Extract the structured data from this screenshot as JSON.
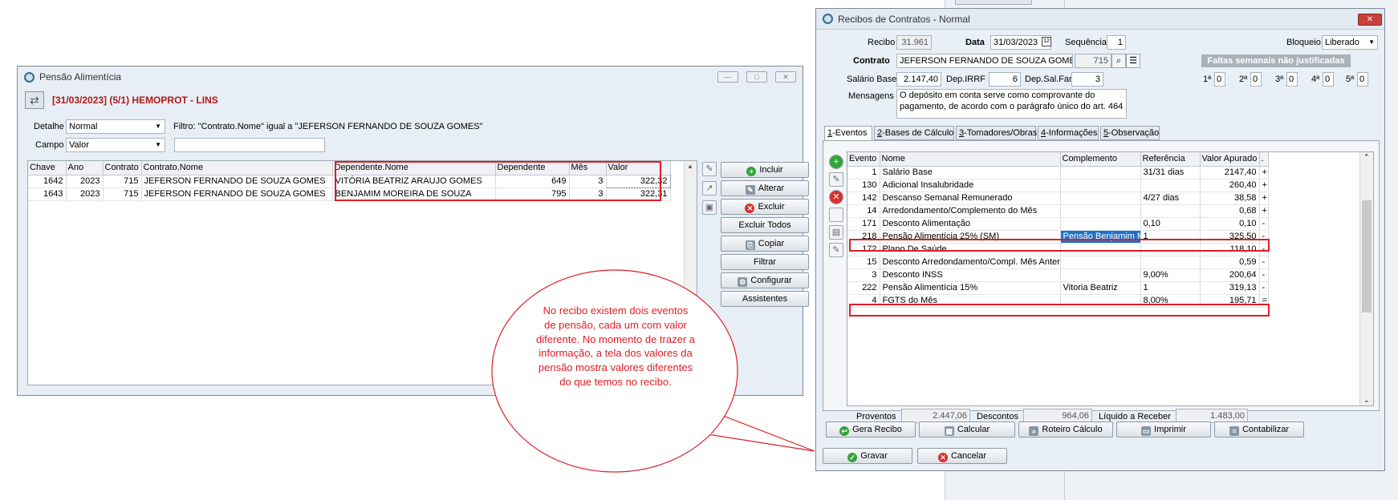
{
  "bg_window": {
    "tab_label": "Excluir Todos"
  },
  "pensao": {
    "title": "Pensão Alimentícia",
    "header": "[31/03/2023] (5/1) HEMOPROT - LINS",
    "detalhe_label": "Detalhe",
    "detalhe_value": "Normal",
    "campo_label": "Campo",
    "campo_value": "Valor",
    "filter_text": "Filtro: \"Contrato.Nome\" igual a \"JEFERSON FERNANDO DE SOUZA GOMES\"",
    "columns": [
      "Chave",
      "Ano",
      "Contrato",
      "Contrato.Nome",
      "Dependente.Nome",
      "Dependente",
      "Mês",
      "Valor"
    ],
    "rows": [
      [
        "1642",
        "2023",
        "715",
        "JEFERSON FERNANDO DE SOUZA GOMES",
        "VITÓRIA BEATRIZ ARAUJO GOMES",
        "649",
        "3",
        "322,32"
      ],
      [
        "1643",
        "2023",
        "715",
        "JEFERSON FERNANDO DE SOUZA GOMES",
        "BENJAMIM MOREIRA DE SOUZA",
        "795",
        "3",
        "322,31"
      ]
    ],
    "buttons": {
      "incluir": "Incluir",
      "alterar": "Alterar",
      "excluir": "Excluir",
      "excluir_todos": "Excluir Todos",
      "copiar": "Copiar",
      "filtrar": "Filtrar",
      "configurar": "Configurar",
      "assistentes": "Assistentes"
    }
  },
  "callout": {
    "text": "No recibo existem dois eventos de pensão, cada um com valor diferente. No momento de trazer a informação, a tela dos valores da pensão mostra valores diferentes do que temos no recibo."
  },
  "recibo": {
    "title": "Recibos de Contratos - Normal",
    "recibo_label": "Recibo",
    "recibo_value": "31.961",
    "data_label": "Data",
    "data_value": "31/03/2023",
    "sequencia_label": "Sequência",
    "sequencia_value": "1",
    "bloqueio_label": "Bloqueio",
    "bloqueio_value": "Liberado",
    "contrato_label": "Contrato",
    "contrato_nome": "JEFERSON FERNANDO DE SOUZA GOMES",
    "contrato_num": "715",
    "salario_label": "Salário Base",
    "salario_value": "2.147,40",
    "dep_irrf_label": "Dep.IRRF",
    "dep_irrf_value": "6",
    "dep_salfam_label": "Dep.Sal.Fam.",
    "dep_salfam_value": "3",
    "mensagens_label": "Mensagens",
    "mensagens_value": "O depósito em conta serve como comprovante do pagamento, de acordo com o parágrafo único do art. 464",
    "faltas_header": "Faltas semanais não justificadas",
    "faltas": [
      {
        "label": "1ª",
        "value": "0"
      },
      {
        "label": "2ª",
        "value": "0"
      },
      {
        "label": "3ª",
        "value": "0"
      },
      {
        "label": "4ª",
        "value": "0"
      },
      {
        "label": "5ª",
        "value": "0"
      }
    ],
    "tabs": [
      {
        "key": "1",
        "label": "-Eventos"
      },
      {
        "key": "2",
        "label": "-Bases de Cálculo"
      },
      {
        "key": "3",
        "label": "-Tomadores/Obras"
      },
      {
        "key": "4",
        "label": "-Informações"
      },
      {
        "key": "5",
        "label": "-Observação"
      }
    ],
    "columns": [
      "Evento",
      "Nome",
      "Complemento",
      "Referência",
      "Valor Apurado",
      "."
    ],
    "events": [
      [
        "1",
        "Salário Base",
        "",
        "31/31 dias",
        "2147,40",
        "+"
      ],
      [
        "130",
        "Adicional Insalubridade",
        "",
        "",
        "260,40",
        "+"
      ],
      [
        "142",
        "Descanso Semanal Remunerado",
        "",
        "4/27 dias",
        "38,58",
        "+"
      ],
      [
        "14",
        "Arredondamento/Complemento do Mês",
        "",
        "",
        "0,68",
        "+"
      ],
      [
        "171",
        "Desconto Alimentação",
        "",
        "0,10",
        "0,10",
        "-"
      ],
      [
        "218",
        "Pensão Alimentícia 25% (SM)",
        "Pensão Benjamim  M",
        "1",
        "325,50",
        "-"
      ],
      [
        "172",
        "Plano De Saúde",
        "",
        "",
        "118,10",
        "-"
      ],
      [
        "15",
        "Desconto Arredondamento/Compl. Mês Anterior",
        "",
        "",
        "0,59",
        "-"
      ],
      [
        "3",
        "Desconto INSS",
        "",
        "9,00%",
        "200,64",
        "-"
      ],
      [
        "222",
        "Pensão Alimentícia 15%",
        "Vitoria Beatriz",
        "1",
        "319,13",
        "-"
      ],
      [
        "4",
        "FGTS do Mês",
        "",
        "8,00%",
        "195,71",
        "="
      ]
    ],
    "proventos_label": "Proventos",
    "proventos_value": "2.447,06",
    "descontos_label": "Descontos",
    "descontos_value": "964,06",
    "liquido_label": "Líquido a Receber",
    "liquido_value": "1.483,00",
    "buttons": {
      "gera_recibo": "Gera Recibo",
      "calcular": "Calcular",
      "roteiro": "Roteiro Cálculo",
      "imprimir": "Imprimir",
      "contabilizar": "Contabilizar",
      "gravar": "Gravar",
      "cancelar": "Cancelar"
    }
  }
}
